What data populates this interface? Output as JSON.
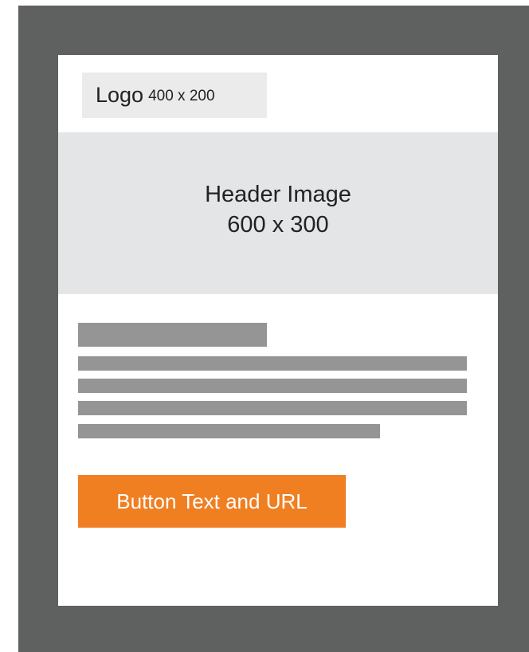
{
  "logo": {
    "word": "Logo",
    "size": "400 x 200"
  },
  "header_image": {
    "line1": "Header Image",
    "line2": "600 x 300"
  },
  "button": {
    "label": "Button Text and URL"
  },
  "colors": {
    "frame": "#5f6060",
    "card": "#ffffff",
    "logo_bg": "#ebebeb",
    "header_bg": "#e4e5e7",
    "text_placeholder": "#959595",
    "button_bg": "#f07f22",
    "button_text": "#ffffff"
  }
}
